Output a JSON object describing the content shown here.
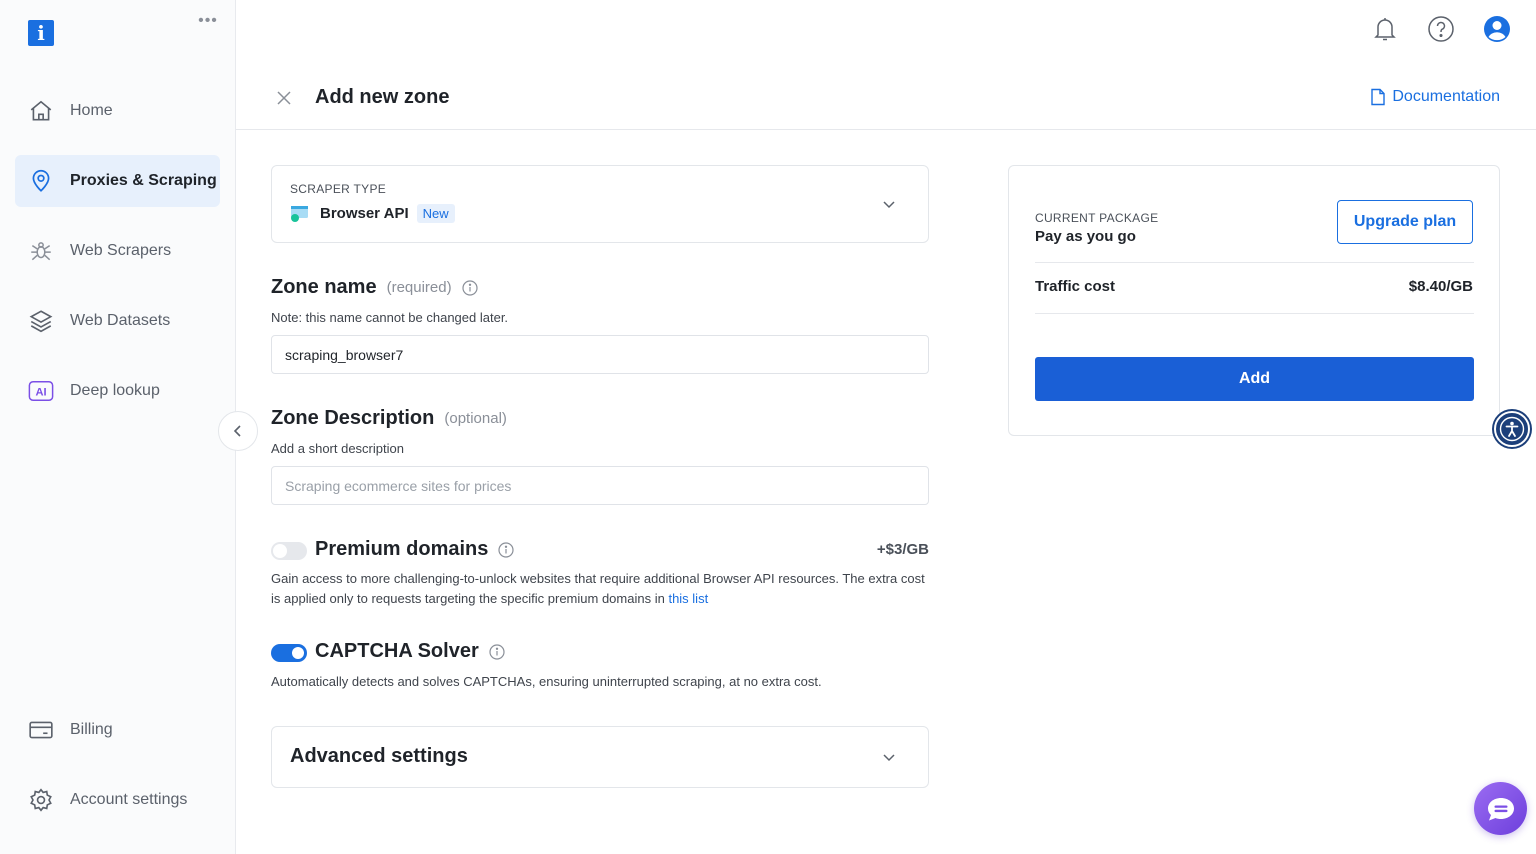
{
  "sidebar": {
    "logo_letter": "i",
    "more_label": "•••",
    "items": [
      {
        "label": "Home",
        "icon": "home-icon"
      },
      {
        "label": "Proxies & Scraping",
        "icon": "location-pin-icon",
        "active": true
      },
      {
        "label": "Web Scrapers",
        "icon": "spider-icon"
      },
      {
        "label": "Web Datasets",
        "icon": "layers-icon"
      },
      {
        "label": "Deep lookup",
        "icon": "ai-icon",
        "icon_text": "AI"
      }
    ],
    "bottom_items": [
      {
        "label": "Billing",
        "icon": "card-icon"
      },
      {
        "label": "Account settings",
        "icon": "gear-icon"
      }
    ]
  },
  "header": {
    "title": "Add new zone",
    "documentation_label": "Documentation",
    "icons": [
      "bell-icon",
      "help-icon",
      "user-icon"
    ]
  },
  "scraper_type": {
    "label": "SCRAPER TYPE",
    "value": "Browser API",
    "badge": "New"
  },
  "zone_name": {
    "title": "Zone name",
    "qualifier": "(required)",
    "note": "Note: this name cannot be changed later.",
    "value": "scraping_browser7"
  },
  "zone_description": {
    "title": "Zone Description",
    "qualifier": "(optional)",
    "note": "Add a short description",
    "placeholder": "Scraping ecommerce sites for prices",
    "value": ""
  },
  "premium_domains": {
    "title": "Premium domains",
    "enabled": false,
    "price": "+$3/GB",
    "description": "Gain access to more challenging-to-unlock websites that require additional Browser API resources. The extra cost is applied only to requests targeting the specific premium domains in",
    "link_label": "this list"
  },
  "captcha_solver": {
    "title": "CAPTCHA Solver",
    "enabled": true,
    "description": "Automatically detects and solves CAPTCHAs, ensuring uninterrupted scraping, at no extra cost."
  },
  "advanced": {
    "title": "Advanced settings"
  },
  "package": {
    "label": "CURRENT PACKAGE",
    "name": "Pay as you go",
    "upgrade_label": "Upgrade plan",
    "traffic_label": "Traffic cost",
    "traffic_value": "$8.40/GB",
    "add_label": "Add"
  },
  "colors": {
    "accent": "#1a6fe0",
    "add_button": "#1a5fd6",
    "active_nav_bg": "#e7f0fc",
    "chat_bubble": "#7b4fe6"
  }
}
